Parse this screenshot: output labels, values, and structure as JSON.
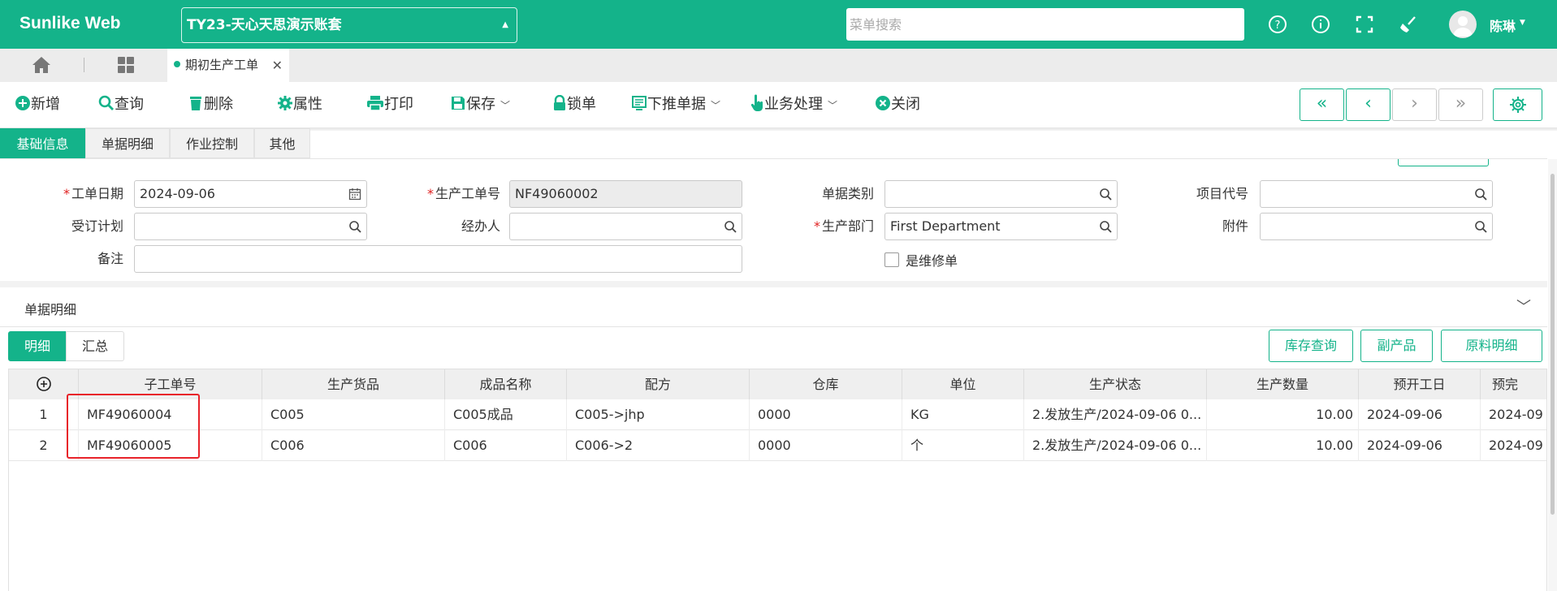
{
  "app": {
    "brand": "Sunlike Web",
    "account": "TY23-天心天思演示账套",
    "search_placeholder": "菜单搜索",
    "user": "陈琳"
  },
  "tabs": {
    "open_page": "期初生产工单"
  },
  "toolbar": {
    "new": "新增",
    "query": "查询",
    "delete": "删除",
    "properties": "属性",
    "print": "打印",
    "save": "保存",
    "lock": "锁单",
    "push_down": "下推单据",
    "business": "业务处理",
    "close": "关闭"
  },
  "section_tabs": [
    "基础信息",
    "单据明细",
    "作业控制",
    "其他"
  ],
  "form": {
    "work_date_label": "工单日期",
    "work_date": "2024-09-06",
    "order_no_label": "生产工单号",
    "order_no": "NF49060002",
    "doc_type_label": "单据类别",
    "doc_type": "",
    "project_code_label": "项目代号",
    "project_code": "",
    "plan_label": "受订计划",
    "plan": "",
    "handler_label": "经办人",
    "handler": "",
    "dept_label": "生产部门",
    "dept": "First Department",
    "attach_label": "附件",
    "attach": "",
    "remark_label": "备注",
    "remark": "",
    "repair_label": "是维修单"
  },
  "detail": {
    "title": "单据明细",
    "subtabs": [
      "明细",
      "汇总"
    ],
    "buttons": [
      "库存查询",
      "副产品",
      "原料明细"
    ],
    "columns": [
      "子工单号",
      "生产货品",
      "成品名称",
      "配方",
      "仓库",
      "单位",
      "生产状态",
      "生产数量",
      "预开工日",
      "预完"
    ],
    "rows": [
      {
        "idx": "1",
        "sub_no": "MF49060004",
        "product": "C005",
        "name": "C005成品",
        "formula": "C005->jhp",
        "warehouse": "0000",
        "unit": "KG",
        "status": "2.发放生产/2024-09-06 0...",
        "qty": "10.00",
        "start": "2024-09-06",
        "end": "2024-09"
      },
      {
        "idx": "2",
        "sub_no": "MF49060005",
        "product": "C006",
        "name": "C006",
        "formula": "C006->2",
        "warehouse": "0000",
        "unit": "个",
        "status": "2.发放生产/2024-09-06 0...",
        "qty": "10.00",
        "start": "2024-09-06",
        "end": "2024-09"
      }
    ]
  },
  "colors": {
    "accent": "#14b38a",
    "highlight": "#e8232a"
  }
}
